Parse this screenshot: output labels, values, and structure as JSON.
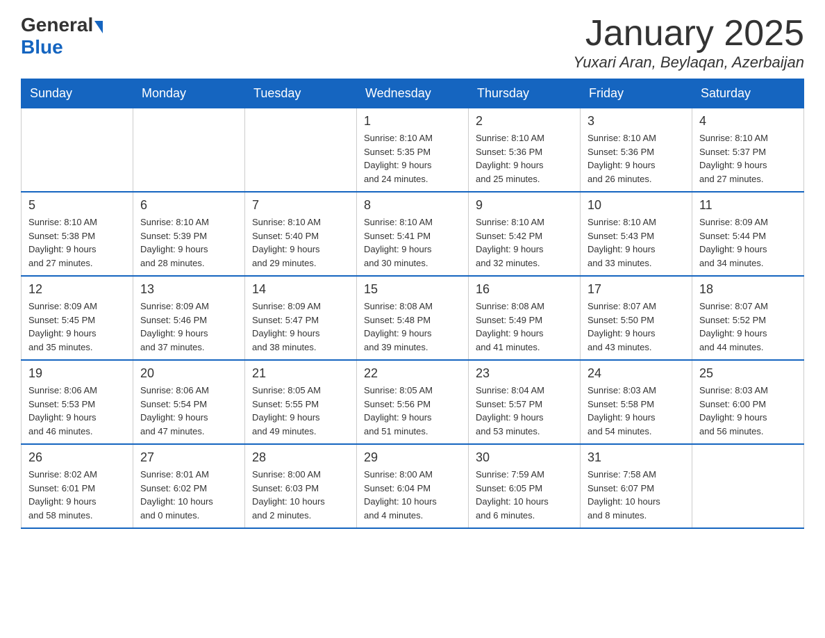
{
  "header": {
    "logo_general": "General",
    "logo_blue": "Blue",
    "title": "January 2025",
    "subtitle": "Yuxari Aran, Beylaqan, Azerbaijan"
  },
  "days_of_week": [
    "Sunday",
    "Monday",
    "Tuesday",
    "Wednesday",
    "Thursday",
    "Friday",
    "Saturday"
  ],
  "weeks": [
    [
      {
        "day": "",
        "info": ""
      },
      {
        "day": "",
        "info": ""
      },
      {
        "day": "",
        "info": ""
      },
      {
        "day": "1",
        "info": "Sunrise: 8:10 AM\nSunset: 5:35 PM\nDaylight: 9 hours\nand 24 minutes."
      },
      {
        "day": "2",
        "info": "Sunrise: 8:10 AM\nSunset: 5:36 PM\nDaylight: 9 hours\nand 25 minutes."
      },
      {
        "day": "3",
        "info": "Sunrise: 8:10 AM\nSunset: 5:36 PM\nDaylight: 9 hours\nand 26 minutes."
      },
      {
        "day": "4",
        "info": "Sunrise: 8:10 AM\nSunset: 5:37 PM\nDaylight: 9 hours\nand 27 minutes."
      }
    ],
    [
      {
        "day": "5",
        "info": "Sunrise: 8:10 AM\nSunset: 5:38 PM\nDaylight: 9 hours\nand 27 minutes."
      },
      {
        "day": "6",
        "info": "Sunrise: 8:10 AM\nSunset: 5:39 PM\nDaylight: 9 hours\nand 28 minutes."
      },
      {
        "day": "7",
        "info": "Sunrise: 8:10 AM\nSunset: 5:40 PM\nDaylight: 9 hours\nand 29 minutes."
      },
      {
        "day": "8",
        "info": "Sunrise: 8:10 AM\nSunset: 5:41 PM\nDaylight: 9 hours\nand 30 minutes."
      },
      {
        "day": "9",
        "info": "Sunrise: 8:10 AM\nSunset: 5:42 PM\nDaylight: 9 hours\nand 32 minutes."
      },
      {
        "day": "10",
        "info": "Sunrise: 8:10 AM\nSunset: 5:43 PM\nDaylight: 9 hours\nand 33 minutes."
      },
      {
        "day": "11",
        "info": "Sunrise: 8:09 AM\nSunset: 5:44 PM\nDaylight: 9 hours\nand 34 minutes."
      }
    ],
    [
      {
        "day": "12",
        "info": "Sunrise: 8:09 AM\nSunset: 5:45 PM\nDaylight: 9 hours\nand 35 minutes."
      },
      {
        "day": "13",
        "info": "Sunrise: 8:09 AM\nSunset: 5:46 PM\nDaylight: 9 hours\nand 37 minutes."
      },
      {
        "day": "14",
        "info": "Sunrise: 8:09 AM\nSunset: 5:47 PM\nDaylight: 9 hours\nand 38 minutes."
      },
      {
        "day": "15",
        "info": "Sunrise: 8:08 AM\nSunset: 5:48 PM\nDaylight: 9 hours\nand 39 minutes."
      },
      {
        "day": "16",
        "info": "Sunrise: 8:08 AM\nSunset: 5:49 PM\nDaylight: 9 hours\nand 41 minutes."
      },
      {
        "day": "17",
        "info": "Sunrise: 8:07 AM\nSunset: 5:50 PM\nDaylight: 9 hours\nand 43 minutes."
      },
      {
        "day": "18",
        "info": "Sunrise: 8:07 AM\nSunset: 5:52 PM\nDaylight: 9 hours\nand 44 minutes."
      }
    ],
    [
      {
        "day": "19",
        "info": "Sunrise: 8:06 AM\nSunset: 5:53 PM\nDaylight: 9 hours\nand 46 minutes."
      },
      {
        "day": "20",
        "info": "Sunrise: 8:06 AM\nSunset: 5:54 PM\nDaylight: 9 hours\nand 47 minutes."
      },
      {
        "day": "21",
        "info": "Sunrise: 8:05 AM\nSunset: 5:55 PM\nDaylight: 9 hours\nand 49 minutes."
      },
      {
        "day": "22",
        "info": "Sunrise: 8:05 AM\nSunset: 5:56 PM\nDaylight: 9 hours\nand 51 minutes."
      },
      {
        "day": "23",
        "info": "Sunrise: 8:04 AM\nSunset: 5:57 PM\nDaylight: 9 hours\nand 53 minutes."
      },
      {
        "day": "24",
        "info": "Sunrise: 8:03 AM\nSunset: 5:58 PM\nDaylight: 9 hours\nand 54 minutes."
      },
      {
        "day": "25",
        "info": "Sunrise: 8:03 AM\nSunset: 6:00 PM\nDaylight: 9 hours\nand 56 minutes."
      }
    ],
    [
      {
        "day": "26",
        "info": "Sunrise: 8:02 AM\nSunset: 6:01 PM\nDaylight: 9 hours\nand 58 minutes."
      },
      {
        "day": "27",
        "info": "Sunrise: 8:01 AM\nSunset: 6:02 PM\nDaylight: 10 hours\nand 0 minutes."
      },
      {
        "day": "28",
        "info": "Sunrise: 8:00 AM\nSunset: 6:03 PM\nDaylight: 10 hours\nand 2 minutes."
      },
      {
        "day": "29",
        "info": "Sunrise: 8:00 AM\nSunset: 6:04 PM\nDaylight: 10 hours\nand 4 minutes."
      },
      {
        "day": "30",
        "info": "Sunrise: 7:59 AM\nSunset: 6:05 PM\nDaylight: 10 hours\nand 6 minutes."
      },
      {
        "day": "31",
        "info": "Sunrise: 7:58 AM\nSunset: 6:07 PM\nDaylight: 10 hours\nand 8 minutes."
      },
      {
        "day": "",
        "info": ""
      }
    ]
  ]
}
